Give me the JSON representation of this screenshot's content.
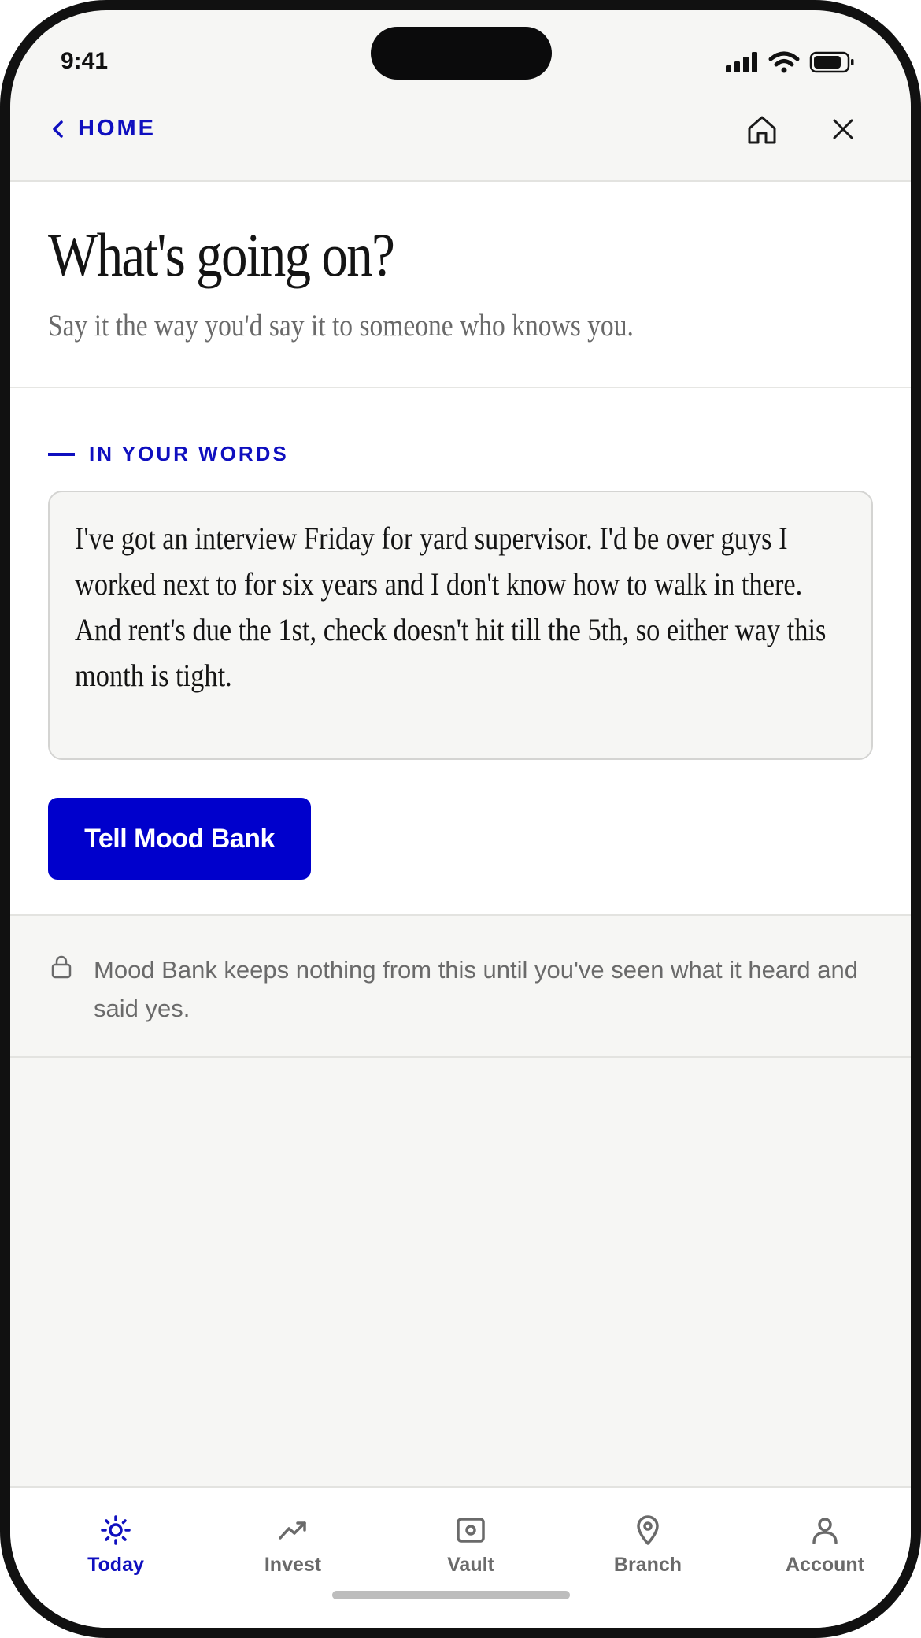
{
  "status_bar": {
    "time": "9:41"
  },
  "nav": {
    "back_label": "HOME"
  },
  "hero": {
    "title": "What's going on?",
    "subtitle": "Say it the way you'd say it to someone who knows you."
  },
  "compose": {
    "section_label": "IN YOUR WORDS",
    "message": "I've got an interview Friday for yard supervisor. I'd be over guys I worked next to for six years and I don't know how to walk in there. And rent's due the 1st, check doesn't hit till the 5th, so either way this month is tight.",
    "submit_label": "Tell Mood Bank"
  },
  "privacy": {
    "icon": "lock-icon",
    "text": "Mood Bank keeps nothing from this until you've seen what it heard and said yes."
  },
  "tabs": [
    {
      "label": "Today",
      "icon": "sun-icon",
      "active": true
    },
    {
      "label": "Invest",
      "icon": "trend-icon",
      "active": false
    },
    {
      "label": "Vault",
      "icon": "vault-icon",
      "active": false
    },
    {
      "label": "Branch",
      "icon": "pin-icon",
      "active": false
    },
    {
      "label": "Account",
      "icon": "person-icon",
      "active": false
    }
  ],
  "colors": {
    "accent": "#0000cc",
    "accent_text": "#0f0fbf",
    "background": "#f6f6f4",
    "muted_text": "#6a6a6a"
  }
}
